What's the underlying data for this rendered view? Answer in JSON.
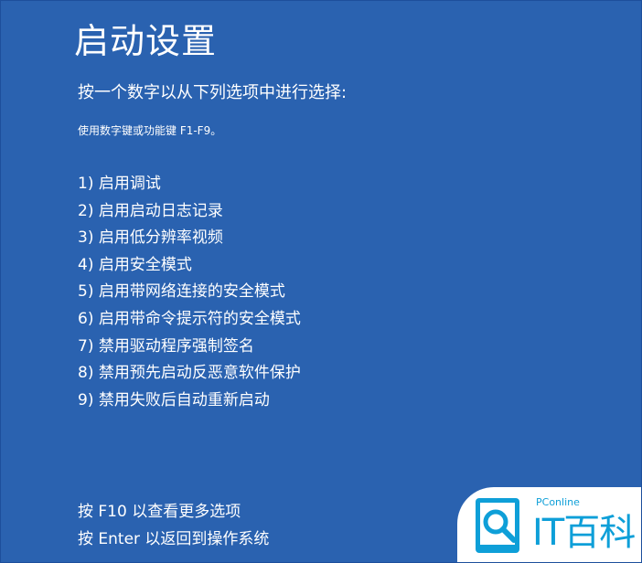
{
  "screen": {
    "title": "启动设置",
    "subtitle": "按一个数字以从下列选项中进行选择:",
    "hint": "使用数字键或功能键 F1-F9。",
    "options": [
      "1) 启用调试",
      "2) 启用启动日志记录",
      "3) 启用低分辨率视频",
      "4) 启用安全模式",
      "5) 启用带网络连接的安全模式",
      "6) 启用带命令提示符的安全模式",
      "7) 禁用驱动程序强制签名",
      "8) 禁用预先启动反恶意软件保护",
      "9) 禁用失败后自动重新启动"
    ],
    "footer": {
      "more_options": "按 F10 以查看更多选项",
      "return_os": "按 Enter 以返回到操作系统"
    }
  },
  "watermark": {
    "brand": "PConline",
    "name": "IT百科",
    "logo_icon": "magnifier-document-icon"
  },
  "colors": {
    "background": "#2a62b0",
    "text": "#ffffff",
    "watermark_accent": "#0e9fd8"
  }
}
